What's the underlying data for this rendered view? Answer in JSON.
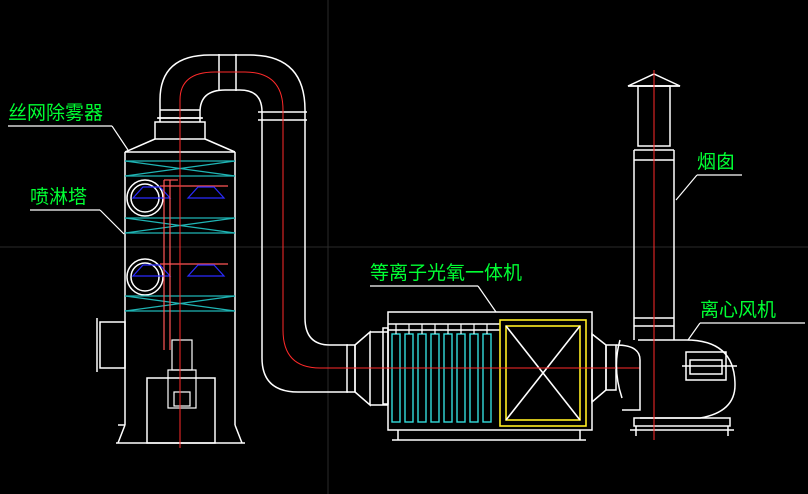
{
  "labels": {
    "mist_eliminator": "丝网除雾器",
    "spray_tower": "喷淋塔",
    "uv_ion_unit": "等离子光氧一体机",
    "chimney": "烟囱",
    "centrifugal_fan": "离心风机"
  },
  "colors": {
    "background": "#000000",
    "outline": "#ffffff",
    "centerline": "#ff2a2a",
    "label_text": "#00ff33",
    "leader": "#ffffff",
    "grid_lines": "#1fb5b5",
    "uv_lamps": "#33dddd",
    "nozzles": "#2a2aff",
    "filter_frame": "#ffee22"
  }
}
